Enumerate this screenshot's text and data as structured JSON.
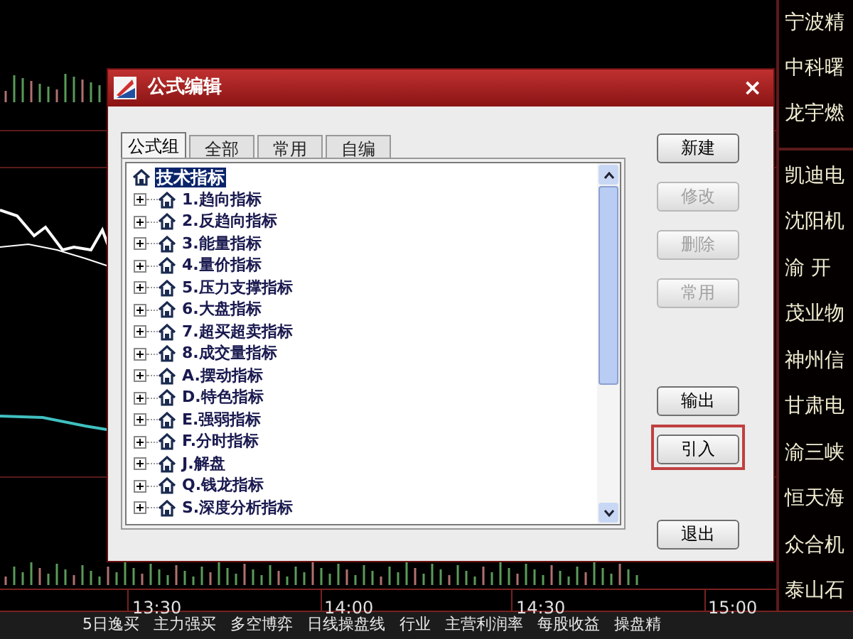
{
  "dialog": {
    "title": "公式编辑",
    "close": "×",
    "tabs": [
      {
        "label": "公式组",
        "selected": true
      },
      {
        "label": "全部",
        "selected": false
      },
      {
        "label": "常用",
        "selected": false
      },
      {
        "label": "自编",
        "selected": false
      }
    ],
    "tree": {
      "root": {
        "label": "技术指标",
        "selected": true
      },
      "children": [
        {
          "label": "1.趋向指标",
          "expanded": false
        },
        {
          "label": "2.反趋向指标",
          "expanded": false
        },
        {
          "label": "3.能量指标",
          "expanded": false
        },
        {
          "label": "4.量价指标",
          "expanded": false
        },
        {
          "label": "5.压力支撑指标",
          "expanded": false
        },
        {
          "label": "6.大盘指标",
          "expanded": false
        },
        {
          "label": "7.超买超卖指标",
          "expanded": false
        },
        {
          "label": "8.成交量指标",
          "expanded": false
        },
        {
          "label": "A.摆动指标",
          "expanded": false
        },
        {
          "label": "D.特色指标",
          "expanded": false
        },
        {
          "label": "E.强弱指标",
          "expanded": false
        },
        {
          "label": "F.分时指标",
          "expanded": false
        },
        {
          "label": "J.解盘",
          "expanded": false
        },
        {
          "label": "Q.钱龙指标",
          "expanded": false
        },
        {
          "label": "S.深度分析指标",
          "expanded": false
        }
      ]
    },
    "button_groups": [
      [
        {
          "label": "新建",
          "disabled": false,
          "highlighted": false
        },
        {
          "label": "修改",
          "disabled": true,
          "highlighted": false
        },
        {
          "label": "删除",
          "disabled": true,
          "highlighted": false
        },
        {
          "label": "常用",
          "disabled": true,
          "highlighted": false
        }
      ],
      [
        {
          "label": "输出",
          "disabled": false,
          "highlighted": false
        },
        {
          "label": "引入",
          "disabled": false,
          "highlighted": true
        }
      ],
      [
        {
          "label": "退出",
          "disabled": false,
          "highlighted": false
        }
      ]
    ]
  },
  "time_axis": [
    "13:30",
    "14:00",
    "14:30",
    "15:00"
  ],
  "stock_list": {
    "top": [
      "宁波精",
      "中科曙",
      "龙宇燃"
    ],
    "bottom": [
      "凯迪电",
      "沈阳机",
      "渝 开",
      "茂业物",
      "神州信",
      "甘肃电",
      "渝三峡",
      "恒天海",
      "众合机",
      "泰山石"
    ]
  },
  "bottom_tabs": [
    "5日逸买",
    "主力强买",
    "多空博弈",
    "日线操盘线",
    "行业",
    "主营利润率",
    "每股收益",
    "操盘精"
  ]
}
